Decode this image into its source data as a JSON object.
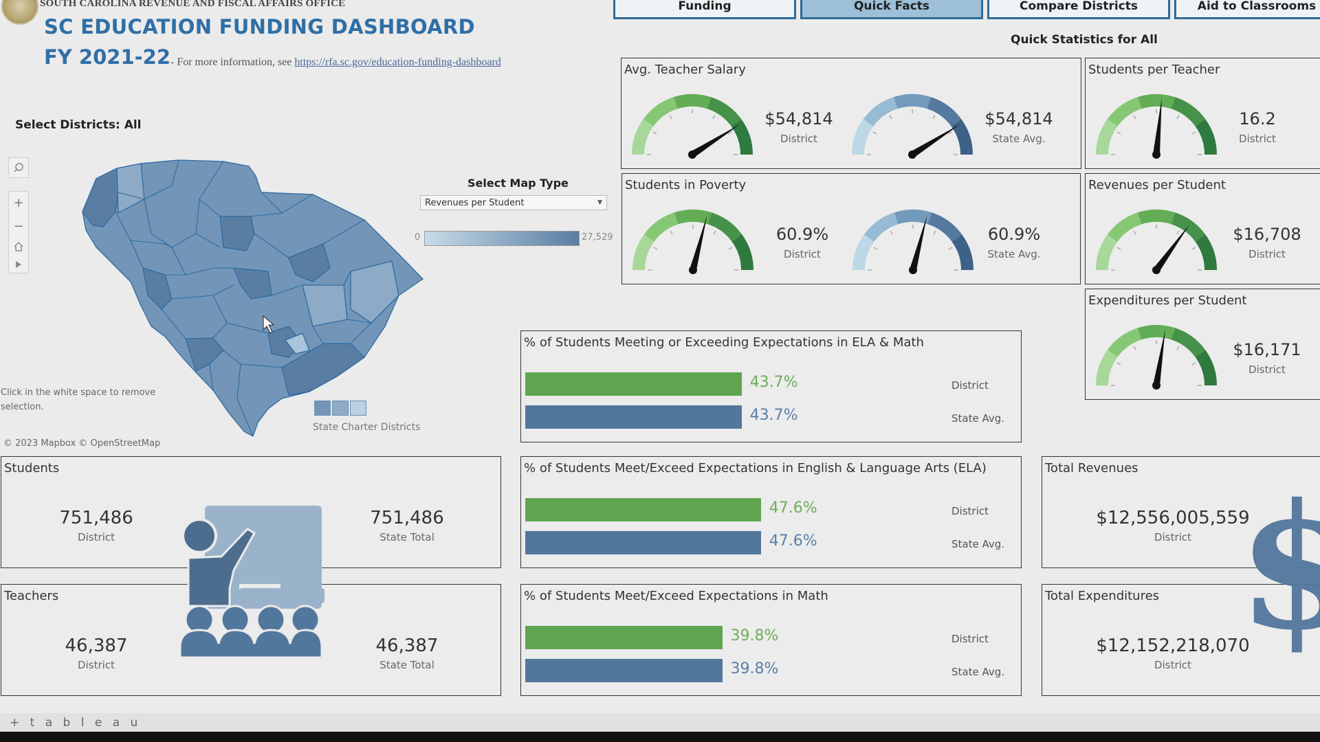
{
  "header": {
    "office": "SOUTH CAROLINA REVENUE AND FISCAL AFFAIRS OFFICE",
    "title": "SC EDUCATION FUNDING DASHBOARD",
    "fiscal_year": "FY 2021-22",
    "more_info_prefix": "- For more information, see",
    "more_info_link": "https://rfa.sc.gov/education-funding-dashboard"
  },
  "tabs": [
    {
      "label": "Funding",
      "active": false
    },
    {
      "label": "Quick Facts",
      "active": true
    },
    {
      "label": "Compare Districts",
      "active": false
    },
    {
      "label": "Aid to Classrooms",
      "active": false
    }
  ],
  "filters": {
    "select_districts_label": "Select Districts:",
    "select_districts_value": "All",
    "map_type_label": "Select Map Type",
    "map_type_value": "Revenues per Student",
    "legend_min": "0",
    "legend_max": "27,529"
  },
  "map": {
    "hint": "Click in the white space to remove selection.",
    "copyright": "© 2023 Mapbox  © OpenStreetMap",
    "charter_label": "State Charter Districts",
    "colors": {
      "dark": "#5a7ea3",
      "mid": "#7396b8",
      "light": "#a9c4da",
      "border": "#2e6aa0"
    }
  },
  "quick_stats": {
    "title": "Quick Statistics for All",
    "gauges": [
      {
        "title": "Avg. Teacher Salary",
        "district": "$54,814",
        "district_label": "District",
        "state": "$54,814",
        "state_label": "State Avg.",
        "needle_fraction": 0.82
      },
      {
        "title": "Students per Teacher",
        "district": "16.2",
        "district_label": "District",
        "needle_fraction": 0.53
      },
      {
        "title": "Students in Poverty",
        "district": "60.9%",
        "district_label": "District",
        "state": "60.9%",
        "state_label": "State Avg.",
        "needle_fraction": 0.58
      },
      {
        "title": "Revenues per Student",
        "district": "$16,708",
        "district_label": "District",
        "needle_fraction": 0.7
      },
      {
        "title": "Expenditures per Student",
        "district": "$16,171",
        "district_label": "District",
        "needle_fraction": 0.55
      }
    ]
  },
  "achievement": [
    {
      "title": "% of Students Meeting or Exceeding Expectations in ELA & Math",
      "district": "43.7%",
      "state": "43.7%",
      "district_value": 43.7,
      "state_value": 43.7,
      "district_label": "District",
      "state_label": "State Avg."
    },
    {
      "title": "% of Students Meet/Exceed Expectations in English & Language Arts (ELA)",
      "district": "47.6%",
      "state": "47.6%",
      "district_value": 47.6,
      "state_value": 47.6,
      "district_label": "District",
      "state_label": "State Avg."
    },
    {
      "title": "% of Students Meet/Exceed Expectations in Math",
      "district": "39.8%",
      "state": "39.8%",
      "district_value": 39.8,
      "state_value": 39.8,
      "district_label": "District",
      "state_label": "State Avg."
    }
  ],
  "counts": {
    "students": {
      "title": "Students",
      "district": "751,486",
      "district_label": "District",
      "state": "751,486",
      "state_label": "State Total"
    },
    "teachers": {
      "title": "Teachers",
      "district": "46,387",
      "district_label": "District",
      "state": "46,387",
      "state_label": "State Total"
    }
  },
  "totals": {
    "revenues": {
      "title": "Total Revenues",
      "value": "$12,556,005,559",
      "label": "District"
    },
    "expenditures": {
      "title": "Total Expenditures",
      "value": "$12,152,218,070",
      "label": "District"
    }
  },
  "colors": {
    "green": "#5fa550",
    "green_text": "#6aae5a",
    "blue": "#52779c",
    "blue_text": "#5b7fa6",
    "title_blue": "#2f6fa6"
  },
  "footer": {
    "brand": "+ t a b l e a u"
  }
}
